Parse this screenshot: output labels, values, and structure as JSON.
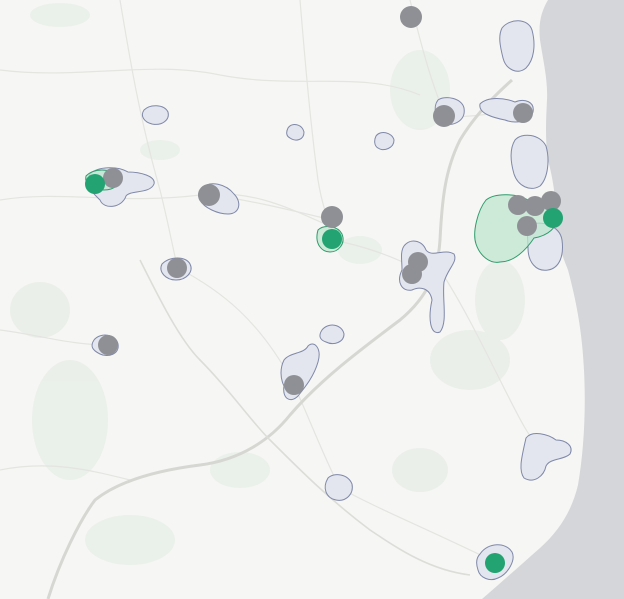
{
  "map": {
    "colors": {
      "land": "#f6f6f4",
      "sea": "#d4d6d9",
      "greenery": "#e8efe8",
      "road_major": "#cfd0cc",
      "road_minor": "#e6e6e3",
      "zone_fill": "#e3e6ee",
      "zone_stroke": "#7f88a8",
      "zone_active_fill": "#bfe6d0",
      "zone_active_stroke": "#2f9c6c",
      "marker_gray": "#8f9096",
      "marker_green": "#22a371"
    },
    "marker_status_legend": {
      "gray": "inactive",
      "green": "active"
    }
  }
}
